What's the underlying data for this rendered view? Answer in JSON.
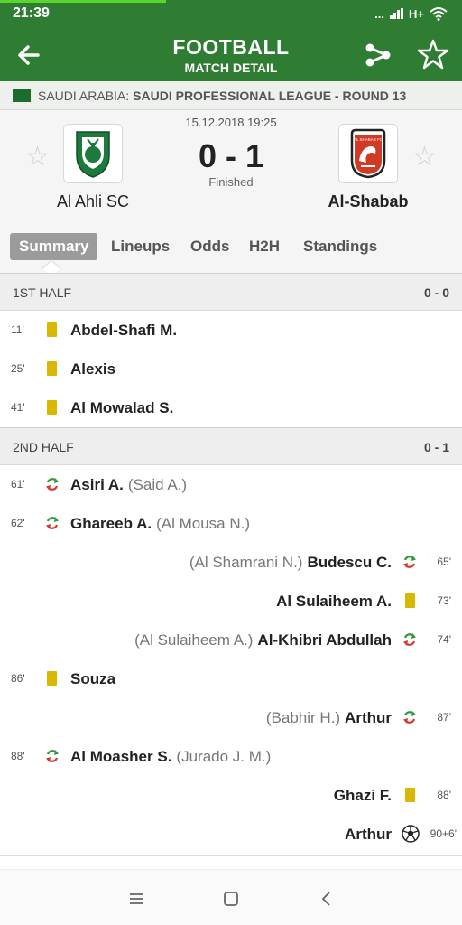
{
  "status_bar": {
    "time": "21:39",
    "dots": "...",
    "network": "H+"
  },
  "header": {
    "title": "FOOTBALL",
    "subtitle": "MATCH DETAIL"
  },
  "league": {
    "country": "SAUDI ARABIA:",
    "name": "SAUDI PROFESSIONAL LEAGUE - ROUND 13"
  },
  "match": {
    "date": "15.12.2018 19:25",
    "score": "0 - 1",
    "status": "Finished",
    "home_team": "Al Ahli SC",
    "away_team": "Al-Shabab",
    "away_logo_text": "AL SHABAB FC"
  },
  "tabs": [
    "Summary",
    "Lineups",
    "Odds",
    "H2H",
    "Standings"
  ],
  "halves": [
    {
      "title": "1ST HALF",
      "score": "0 - 0"
    },
    {
      "title": "2ND HALF",
      "score": "0 - 1"
    }
  ],
  "events": [
    {
      "minute": "11'",
      "type": "yellow",
      "player": "Abdel-Shafi M.",
      "sub": ""
    },
    {
      "minute": "25'",
      "type": "yellow",
      "player": "Alexis",
      "sub": ""
    },
    {
      "minute": "41'",
      "type": "yellow",
      "player": "Al Mowalad S.",
      "sub": ""
    },
    {
      "minute": "61'",
      "type": "subst",
      "player": "Asiri A.",
      "sub": "(Said A.)"
    },
    {
      "minute": "62'",
      "type": "subst",
      "player": "Ghareeb A.",
      "sub": "(Al Mousa N.)"
    },
    {
      "minute": "65'",
      "type": "subst",
      "player": "Budescu C.",
      "sub": "(Al Shamrani N.)"
    },
    {
      "minute": "73'",
      "type": "yellow",
      "player": "Al Sulaiheem A.",
      "sub": ""
    },
    {
      "minute": "74'",
      "type": "subst",
      "player": "Al-Khibri Abdullah",
      "sub": "(Al Sulaiheem A.)"
    },
    {
      "minute": "86'",
      "type": "yellow",
      "player": "Souza",
      "sub": ""
    },
    {
      "minute": "87'",
      "type": "subst",
      "player": "Arthur",
      "sub": "(Babhir H.)"
    },
    {
      "minute": "88'",
      "type": "subst",
      "player": "Al Moasher S.",
      "sub": "(Jurado J. M.)"
    },
    {
      "minute": "88'",
      "type": "yellow",
      "player": "Ghazi F.",
      "sub": ""
    },
    {
      "minute": "90+6'",
      "type": "goal",
      "player": "Arthur",
      "sub": ""
    }
  ],
  "colors": {
    "header": "#2e7d32",
    "yellow_card": "#d8b800",
    "sub_in": "#2e9a3a",
    "sub_out": "#d63a2c"
  }
}
